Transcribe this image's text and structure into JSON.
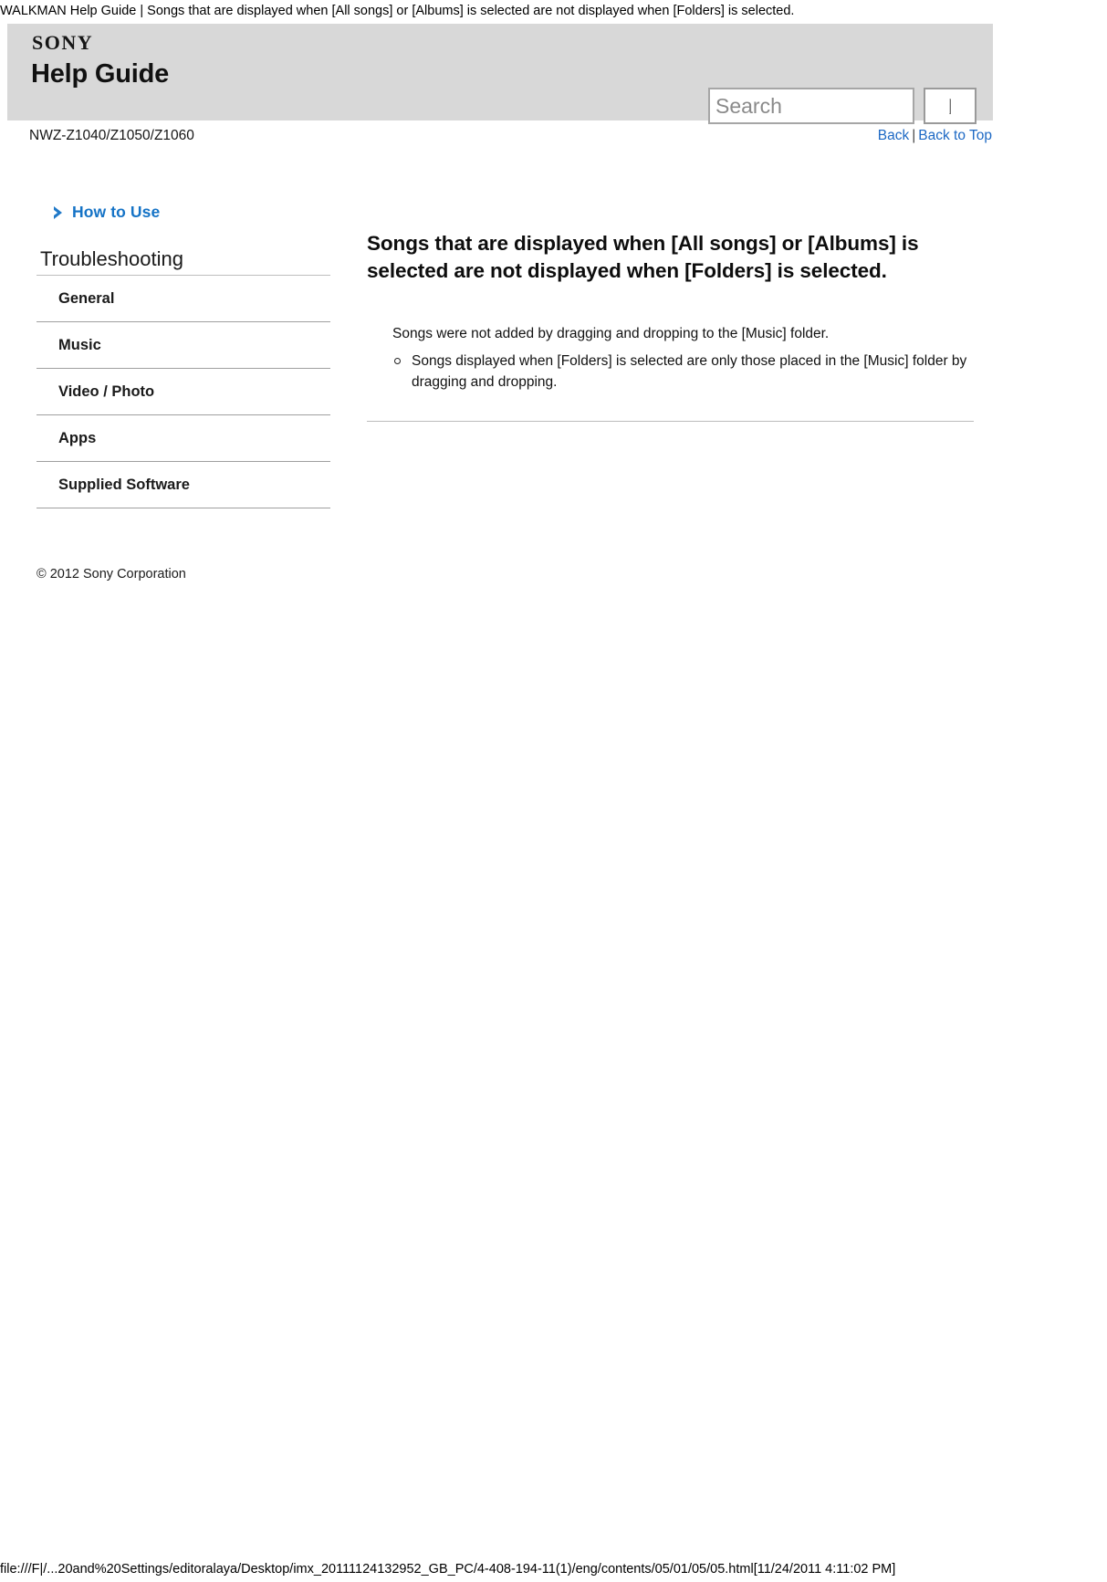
{
  "print_header": "WALKMAN Help Guide | Songs that are displayed when [All songs] or [Albums] is selected are not displayed when [Folders] is selected.",
  "masthead": {
    "logo": "SONY",
    "title": "Help Guide",
    "search": {
      "placeholder": "Search",
      "value": "",
      "button_label": ""
    }
  },
  "subheader": {
    "model": "NWZ-Z1040/Z1050/Z1060",
    "links": [
      {
        "label": "Back"
      },
      {
        "label": "Back to Top"
      }
    ],
    "separator": "|"
  },
  "sidebar": {
    "how_to_use": "How to Use",
    "section_title": "Troubleshooting",
    "items": [
      {
        "label": "General"
      },
      {
        "label": "Music"
      },
      {
        "label": "Video / Photo"
      },
      {
        "label": "Apps"
      },
      {
        "label": "Supplied Software"
      }
    ]
  },
  "copyright": "© 2012 Sony Corporation",
  "content": {
    "heading": "Songs that are displayed when [All songs] or [Albums] is selected are not displayed when [Folders] is selected.",
    "lead": "Songs were not added by dragging and dropping to the [Music] folder.",
    "bullets": [
      "Songs displayed when [Folders] is selected are only those placed in the [Music] folder by dragging and dropping."
    ]
  },
  "status_bar": {
    "url": "file:///F|/...20and%20Settings/editoralaya/Desktop/imx_20111124132952_GB_PC/4-408-194-11(1)/eng/contents/05/01/05/05.html[11/24/2011 4:11:02 PM]"
  },
  "colors": {
    "link": "#1c68c4",
    "accent": "#1573c6",
    "masthead_bg": "#d8d8d8"
  }
}
